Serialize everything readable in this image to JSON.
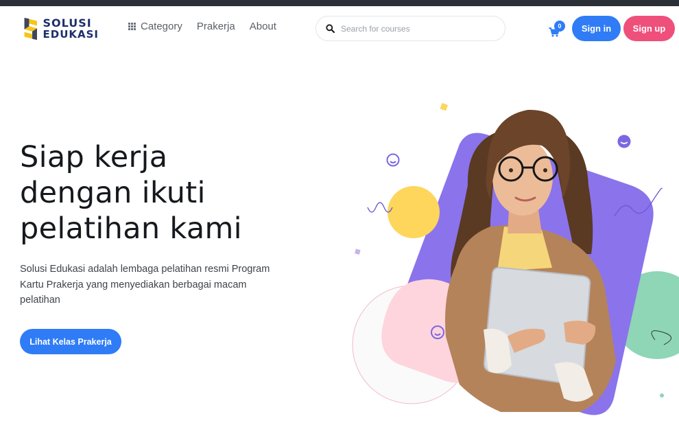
{
  "brand": {
    "line1": "SOLUSI",
    "line2": "EDUKASI",
    "colors": {
      "navy": "#1d2e6b",
      "yellow": "#f5c518"
    }
  },
  "nav": {
    "items": [
      {
        "label": "Category",
        "icon": "grid-icon"
      },
      {
        "label": "Prakerja"
      },
      {
        "label": "About"
      }
    ]
  },
  "search": {
    "placeholder": "Search for courses",
    "value": "",
    "icon": "search-icon"
  },
  "cart": {
    "icon": "cart-icon",
    "count": "0"
  },
  "auth": {
    "signin_label": "Sign in",
    "signup_label": "Sign up"
  },
  "hero": {
    "title_line1": "Siap kerja",
    "title_line2": "dengan ikuti",
    "title_line3": "pelatihan kami",
    "description": "Solusi Edukasi adalah lembaga pelatihan resmi Program Kartu Prakerja yang menyediakan berbagai macam pelatihan",
    "cta_label": "Lihat Kelas Prakerja"
  },
  "colors": {
    "primary": "#2f7cf6",
    "secondary": "#ef4f7b",
    "purple_shape": "#8b73ec",
    "yellow_circle": "#fdd65b",
    "pink_shape": "#fed5dc",
    "green_shape": "#8ed6b6",
    "topbar": "#2b2f36"
  }
}
